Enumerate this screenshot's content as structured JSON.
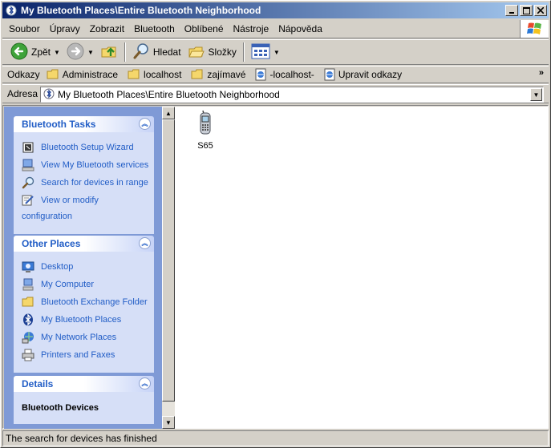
{
  "window": {
    "title": "My Bluetooth Places\\Entire Bluetooth Neighborhood",
    "minimize": "_",
    "maximize": "□",
    "close": "✕"
  },
  "menu": {
    "items": [
      "Soubor",
      "Úpravy",
      "Zobrazit",
      "Bluetooth",
      "Oblíbené",
      "Nástroje",
      "Nápověda"
    ]
  },
  "toolbar": {
    "back_label": "Zpět",
    "search_label": "Hledat",
    "folders_label": "Složky"
  },
  "links": {
    "label": "Odkazy",
    "items": [
      "Administrace",
      "localhost",
      "zajímavé",
      "-localhost-",
      "Upravit odkazy"
    ],
    "more": "»"
  },
  "address": {
    "label": "Adresa",
    "value": "My Bluetooth Places\\Entire Bluetooth Neighborhood"
  },
  "panels": {
    "tasks": {
      "title": "Bluetooth Tasks",
      "items": [
        "Bluetooth Setup Wizard",
        "View My Bluetooth services",
        "Search for devices in range",
        "View or modify",
        "configuration"
      ]
    },
    "places": {
      "title": "Other Places",
      "items": [
        "Desktop",
        "My Computer",
        "Bluetooth Exchange Folder",
        "My Bluetooth Places",
        "My Network Places",
        "Printers and Faxes"
      ]
    },
    "details": {
      "title": "Details",
      "body": "Bluetooth Devices"
    }
  },
  "devices": [
    {
      "name": "S65",
      "icon": "mobile-phone-icon"
    }
  ],
  "status": {
    "text": "The search for devices has finished"
  },
  "colors": {
    "titlebar_start": "#0a246a",
    "titlebar_end": "#a6caf0",
    "panel_link": "#215dc6",
    "pane_bg": "#7f9ad6",
    "panel_body": "#d6dff7"
  }
}
